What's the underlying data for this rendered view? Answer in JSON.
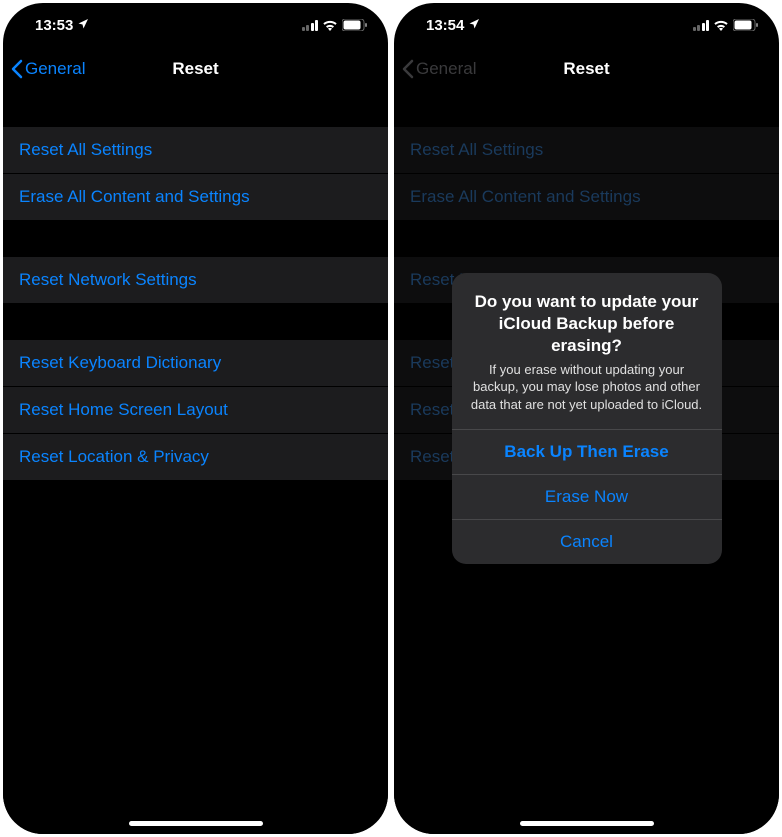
{
  "left": {
    "status": {
      "time": "13:53"
    },
    "nav": {
      "back": "General",
      "title": "Reset"
    },
    "groups": [
      [
        "Reset All Settings",
        "Erase All Content and Settings"
      ],
      [
        "Reset Network Settings"
      ],
      [
        "Reset Keyboard Dictionary",
        "Reset Home Screen Layout",
        "Reset Location & Privacy"
      ]
    ]
  },
  "right": {
    "status": {
      "time": "13:54"
    },
    "nav": {
      "back": "General",
      "title": "Reset"
    },
    "groups": [
      [
        "Reset All Settings",
        "Erase All Content and Settings"
      ],
      [
        "Reset Network Settings"
      ],
      [
        "Reset Keyboard Dictionary",
        "Reset Home Screen Layout",
        "Reset Location & Privacy"
      ]
    ],
    "alert": {
      "title": "Do you want to update your iCloud Backup before erasing?",
      "message": "If you erase without updating your backup, you may lose photos and other data that are not yet uploaded to iCloud.",
      "buttons": [
        "Back Up Then Erase",
        "Erase Now",
        "Cancel"
      ]
    }
  }
}
